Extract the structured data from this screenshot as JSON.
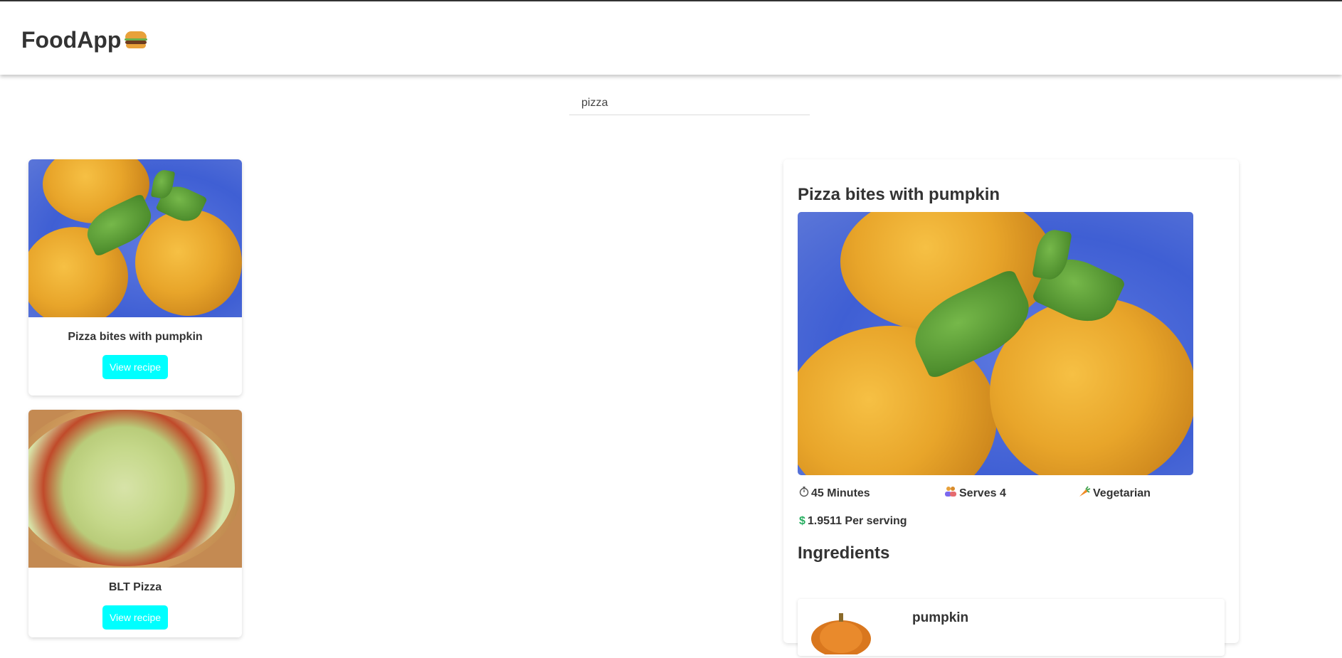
{
  "app": {
    "brand": "FoodApp",
    "brand_icon": "burger-icon"
  },
  "search": {
    "value": "pizza",
    "placeholder": ""
  },
  "results": [
    {
      "title": "Pizza bites with pumpkin",
      "button": "View recipe"
    },
    {
      "title": "BLT Pizza",
      "button": "View recipe"
    }
  ],
  "detail": {
    "title": "Pizza bites with pumpkin",
    "time": "45 Minutes",
    "serves": "Serves 4",
    "diet": "Vegetarian",
    "price": "1.9511 Per serving",
    "ingredients_heading": "Ingredients",
    "ingredients": [
      {
        "name": "pumpkin"
      }
    ]
  },
  "colors": {
    "button_bg": "#00ffff",
    "price_icon": "#27ae60",
    "text": "#333333"
  }
}
